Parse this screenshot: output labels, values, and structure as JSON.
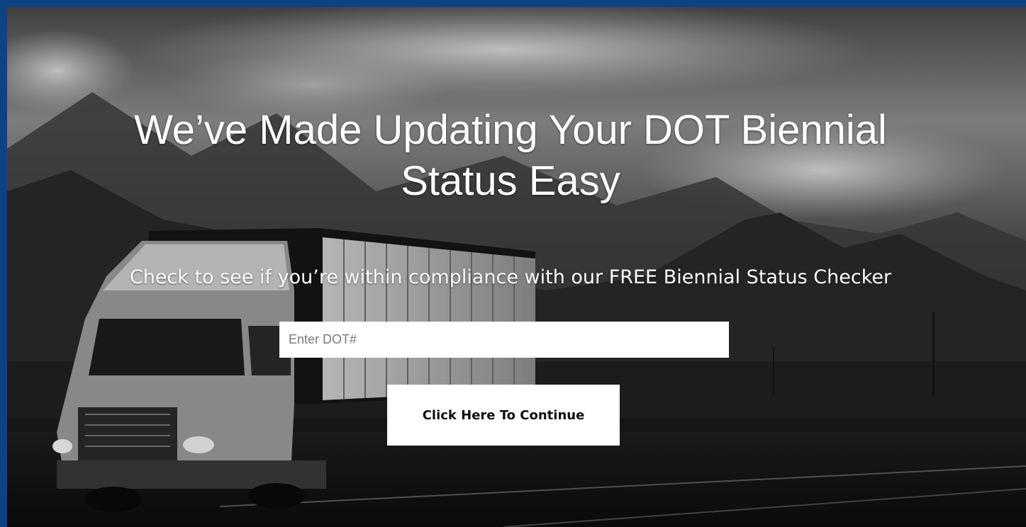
{
  "hero": {
    "headline_line1": "We’ve Made Updating Your DOT Biennial",
    "headline_line2": "Status Easy",
    "subheadline": "Check to see if you’re within compliance with our FREE Biennial Status Checker"
  },
  "form": {
    "dot_input_placeholder": "Enter DOT#",
    "dot_input_value": "",
    "continue_label": "Click Here To Continue"
  },
  "colors": {
    "frame": "#0d4383",
    "button_bg": "#ffffff",
    "headline_text": "#ffffff"
  }
}
